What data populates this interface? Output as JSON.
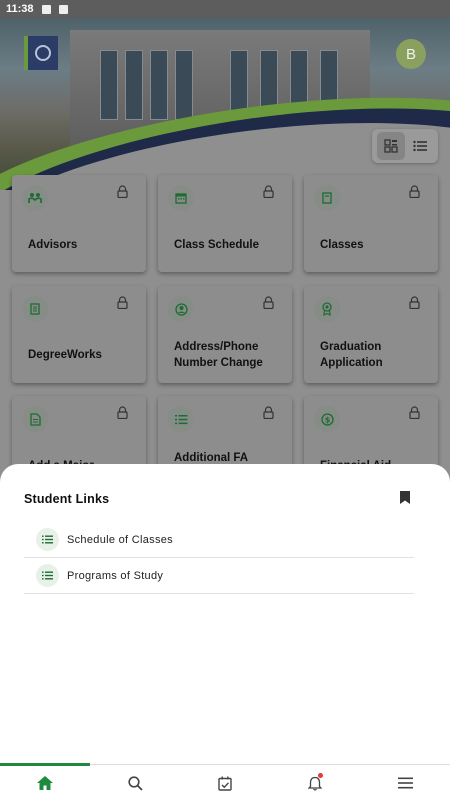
{
  "status_bar": {
    "time": "11:38"
  },
  "header": {
    "avatar_initial": "B"
  },
  "colors": {
    "accent_green": "#1e8a3e",
    "brand_navy": "#2b3c66",
    "brand_green": "#6b9a3c"
  },
  "tiles": [
    {
      "label": "Advisors",
      "icon": "advisors-icon"
    },
    {
      "label": "Class Schedule",
      "icon": "calendar-icon"
    },
    {
      "label": "Classes",
      "icon": "book-icon"
    },
    {
      "label": "DegreeWorks",
      "icon": "notebook-icon"
    },
    {
      "label": "Address/Phone Number Change",
      "icon": "account-circle-icon"
    },
    {
      "label": "Graduation Application",
      "icon": "award-icon"
    },
    {
      "label": "Add a Major",
      "icon": "document-icon"
    },
    {
      "label": "Additional FA",
      "icon": "list-icon"
    },
    {
      "label": "Financial Aid",
      "icon": "dollar-icon"
    }
  ],
  "sheet": {
    "title": "Student Links",
    "links": [
      {
        "label": "Schedule of Classes"
      },
      {
        "label": "Programs of Study"
      }
    ]
  },
  "bottom_nav": [
    {
      "name": "home",
      "icon": "home-icon",
      "active": true
    },
    {
      "name": "search",
      "icon": "search-icon"
    },
    {
      "name": "tasks",
      "icon": "calendar-check-icon"
    },
    {
      "name": "notifications",
      "icon": "bell-icon"
    },
    {
      "name": "menu",
      "icon": "hamburger-icon"
    }
  ]
}
